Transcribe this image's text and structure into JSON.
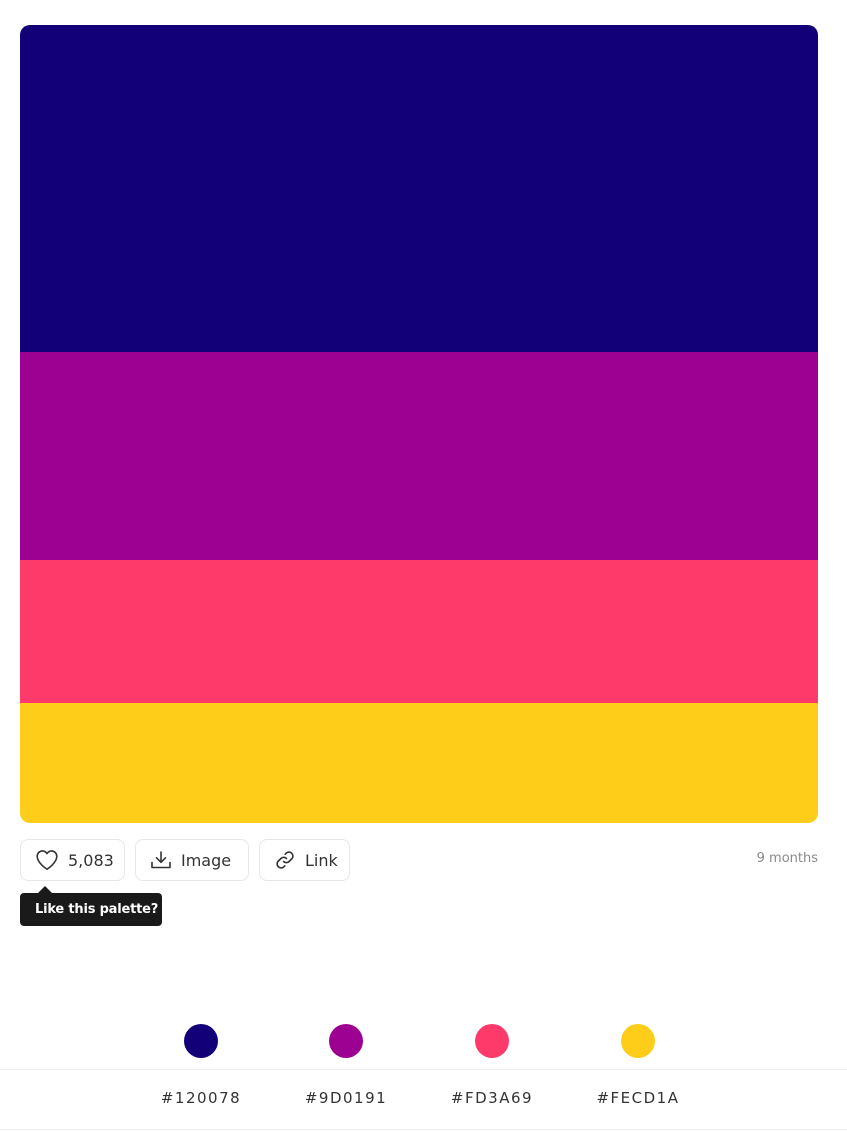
{
  "palette": {
    "colors": [
      {
        "hex": "#120078",
        "label": "#120078",
        "share": 0.41
      },
      {
        "hex": "#9D0191",
        "label": "#9D0191",
        "share": 0.26
      },
      {
        "hex": "#FD3A69",
        "label": "#FD3A69",
        "share": 0.18
      },
      {
        "hex": "#FECD1A",
        "label": "#FECD1A",
        "share": 0.15
      }
    ]
  },
  "actions": {
    "like_count": "5,083",
    "image_label": "Image",
    "link_label": "Link"
  },
  "time_ago": "9 months",
  "tooltip": "Like this palette?",
  "icons": {
    "like": "heart-icon",
    "image": "download-icon",
    "link": "link-icon"
  }
}
